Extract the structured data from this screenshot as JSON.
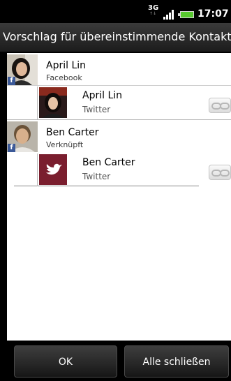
{
  "status_bar": {
    "network": "3G",
    "time": "17:07"
  },
  "title": "Vorschlag für übereinstimmende Kontakte",
  "groups": [
    {
      "contact": {
        "name": "April Lin",
        "source": "Facebook",
        "avatar_badge": "f"
      },
      "match": {
        "name": "April Lin",
        "source": "Twitter"
      }
    },
    {
      "contact": {
        "name": "Ben Carter",
        "source": "Verknüpft",
        "avatar_badge": "f"
      },
      "match": {
        "name": "Ben Carter",
        "source": "Twitter"
      }
    }
  ],
  "buttons": {
    "ok": "OK",
    "close_all": "Alle schließen"
  },
  "colors": {
    "facebook": "#3b5998",
    "twitter_bg": "#7a1e2e",
    "battery": "#58c92f"
  }
}
